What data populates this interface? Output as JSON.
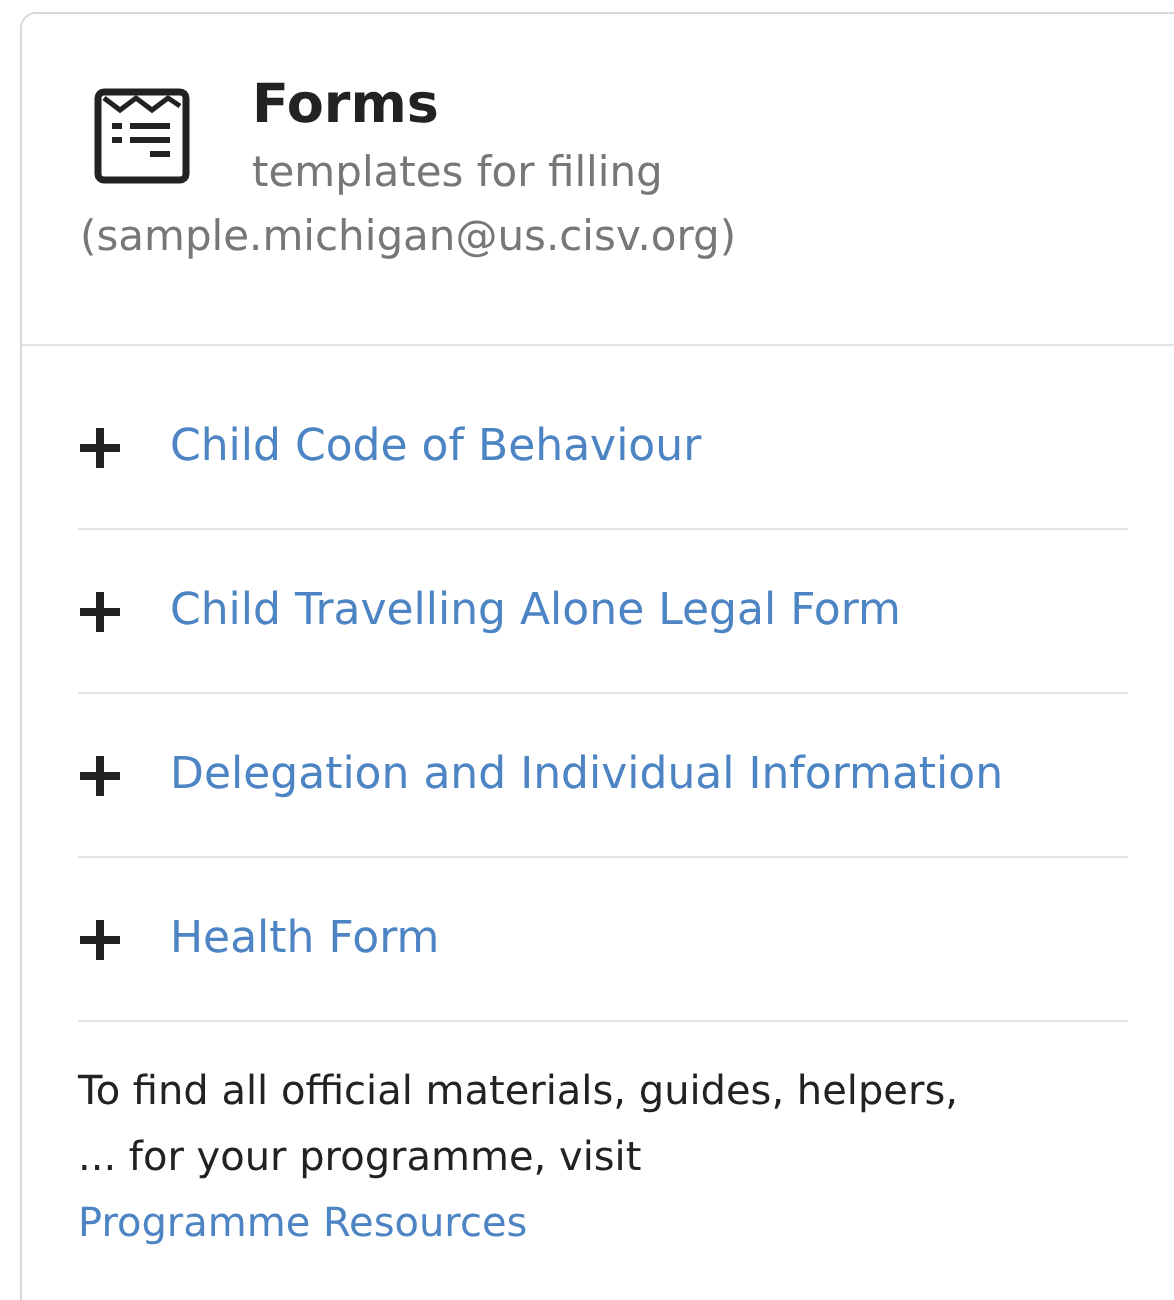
{
  "card": {
    "title": "Forms",
    "subtitle": "templates for filling",
    "account": "(sample.michigan@us.cisv.org)"
  },
  "forms": [
    {
      "label": "Child Code of Behaviour",
      "expanded": false
    },
    {
      "label": "Child Travelling Alone Legal Form",
      "expanded": false
    },
    {
      "label": "Delegation and Individual Information",
      "expanded": false
    },
    {
      "label": "Health Form",
      "expanded": false
    }
  ],
  "footer": {
    "text": "To find all official materials, guides, helpers, ... for your programme, visit",
    "link": "Programme Resources"
  }
}
